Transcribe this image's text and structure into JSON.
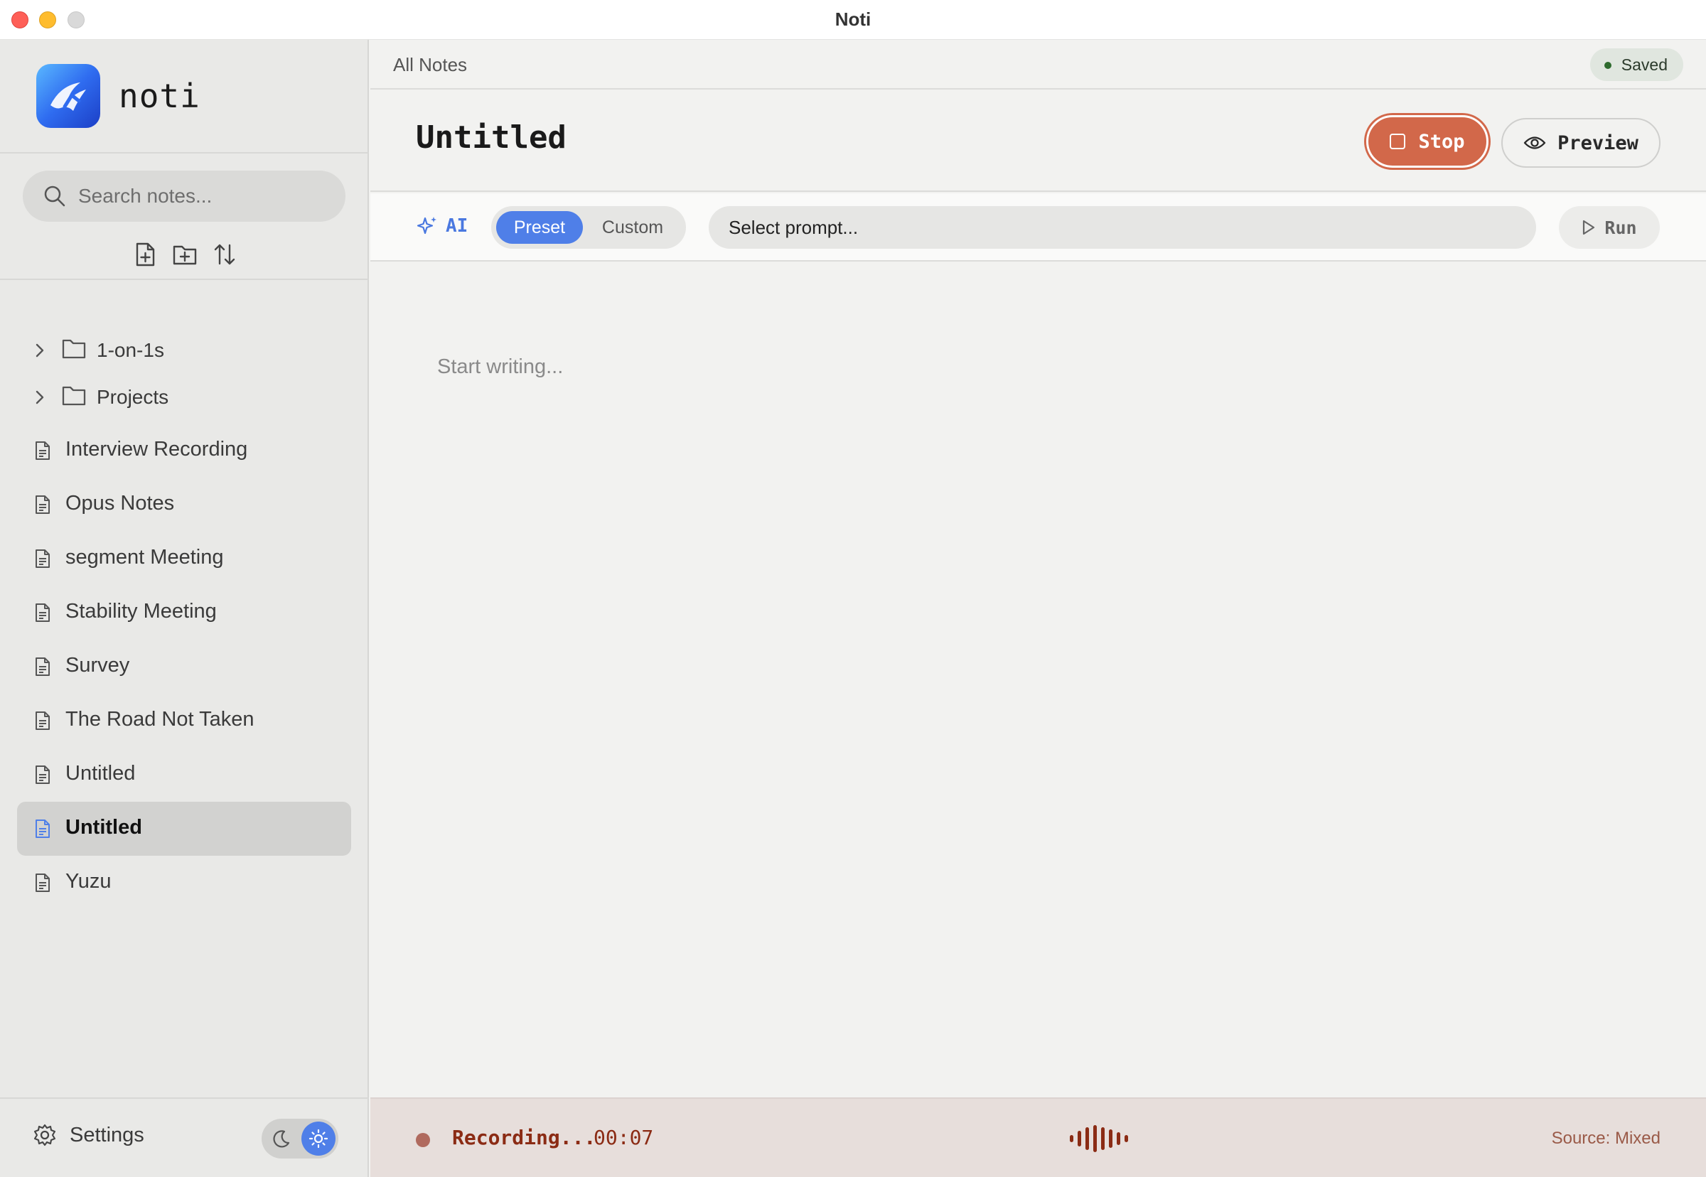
{
  "window": {
    "title": "Noti"
  },
  "sidebar": {
    "brand_name": "noti",
    "search_placeholder": "Search notes...",
    "folders": [
      {
        "label": "1-on-1s"
      },
      {
        "label": "Projects"
      }
    ],
    "notes": [
      {
        "label": "Interview Recording"
      },
      {
        "label": "Opus Notes"
      },
      {
        "label": "segment Meeting"
      },
      {
        "label": "Stability Meeting"
      },
      {
        "label": "Survey"
      },
      {
        "label": "The Road Not Taken"
      },
      {
        "label": "Untitled"
      },
      {
        "label": "Untitled",
        "selected": true
      },
      {
        "label": "Yuzu"
      }
    ],
    "settings_label": "Settings",
    "theme": "light"
  },
  "main": {
    "breadcrumb": "All Notes",
    "save_status": "Saved",
    "note_title": "Untitled",
    "stop_label": "Stop",
    "preview_label": "Preview",
    "ai": {
      "label": "AI",
      "mode_preset": "Preset",
      "mode_custom": "Custom",
      "active_mode": "Preset",
      "prompt_placeholder": "Select prompt...",
      "run_label": "Run"
    },
    "editor_placeholder": "Start writing...",
    "recording": {
      "status": "Recording...",
      "elapsed": "00:07",
      "source": "Source: Mixed"
    }
  },
  "colors": {
    "accent_blue": "#4f7fe8",
    "stop_red": "#d2684a",
    "recording_text": "#8b2b14",
    "sidebar_bg": "#e9e9e7",
    "main_bg": "#f2f2f0"
  },
  "icons": {
    "search": "search-icon",
    "new_note": "new-note-icon",
    "new_folder": "new-folder-icon",
    "sort": "sort-icon",
    "folder": "folder-icon",
    "chevron": "chevron-right-icon",
    "note": "document-icon",
    "settings": "gear-icon",
    "moon": "moon-icon",
    "sun": "sun-icon",
    "sparkles": "sparkles-icon",
    "eye": "eye-icon",
    "play": "play-icon",
    "stop": "stop-square-icon",
    "waveform": "waveform-icon"
  }
}
